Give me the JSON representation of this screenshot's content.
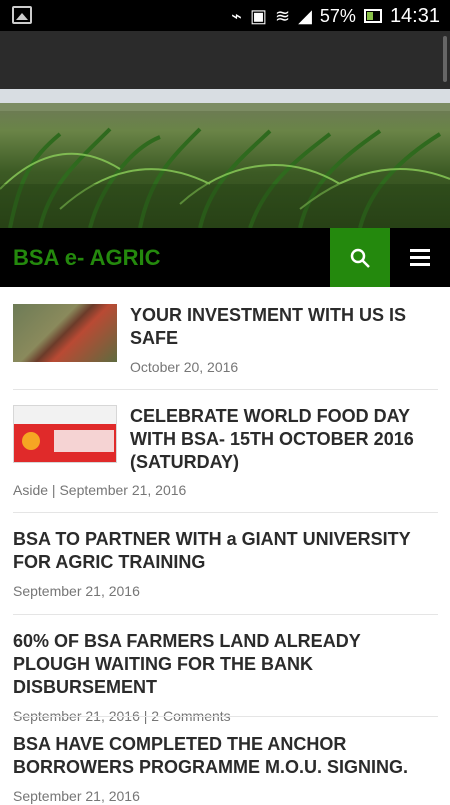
{
  "status_bar": {
    "battery": "57%",
    "time": "14:31",
    "icons": [
      "image-icon",
      "vibrate-icon",
      "no-sim-icon",
      "wifi-icon",
      "signal-icon",
      "battery-icon"
    ]
  },
  "site": {
    "title": "BSA e- AGRIC",
    "accent_color": "#24890d"
  },
  "posts": [
    {
      "title": "YOUR INVESTMENT WITH US IS SAFE",
      "meta": "October 20, 2016",
      "thumbnail": "farm-machine"
    },
    {
      "title": "CELEBRATE WORLD FOOD DAY WITH BSA- 15TH OCTOBER 2016 (SATURDAY)",
      "meta_prefix": "Aside",
      "meta": "September 21, 2016",
      "thumbnail": "world-food-day-flyer"
    },
    {
      "title": "BSA TO PARTNER WITH a GIANT UNIVERSITY FOR AGRIC TRAINING",
      "meta": "September 21, 2016"
    },
    {
      "title": "60% OF BSA FARMERS LAND ALREADY PLOUGH WAITING FOR THE BANK DISBURSEMENT",
      "meta": "September 21, 2016",
      "comments": "2 Comments"
    },
    {
      "title": "BSA HAVE COMPLETED THE ANCHOR BORROWERS PROGRAMME M.O.U. SIGNING.",
      "meta": "September 21, 2016"
    }
  ]
}
